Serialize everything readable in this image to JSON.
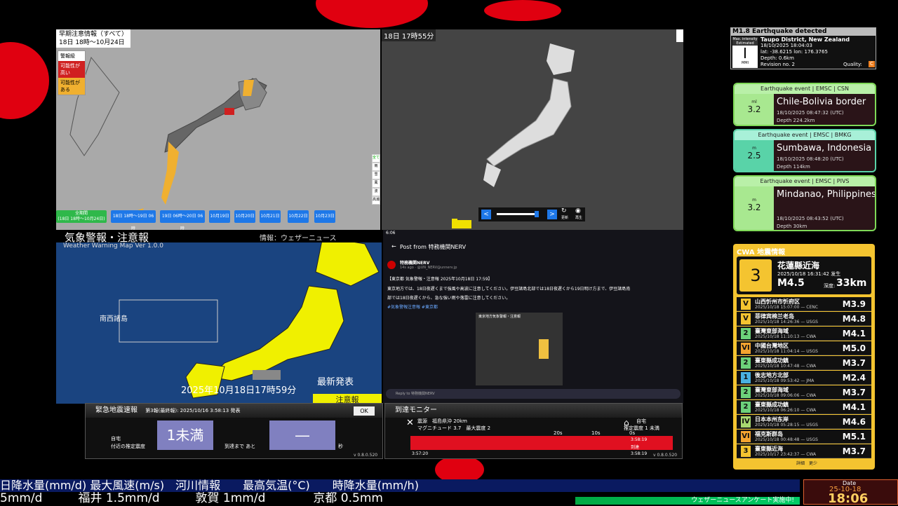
{
  "warning_map": {
    "title_line1": "早期注意情報（すべて）",
    "title_line2": "18日 18時〜10月24日",
    "legend": [
      "警報級",
      "可能性が高い",
      "可能性がある"
    ],
    "day_buttons": [
      "全期間\n(18日 18時〜10月24日)",
      "18日 18時〜19日 06時",
      "19日 06時〜20日 06時",
      "10月19日",
      "10月20日",
      "10月21日",
      "10月22日",
      "10月23日"
    ],
    "side_buttons": [
      "全て",
      "雨",
      "雪",
      "風",
      "波",
      "高潮"
    ]
  },
  "radar_map": {
    "title": "18日 17時55分",
    "controls": [
      "更新",
      "再生"
    ]
  },
  "weather_warning": {
    "title": "気象警報・注意報",
    "subtitle": "Weather Warning Map Ver 1.0.0",
    "info": "情報：ウェザーニュース",
    "region_label": "南西諸島",
    "latest": "最新発表",
    "timestamp": "2025年10月18日17時59分",
    "footer_tag": "注意報"
  },
  "social_post": {
    "status_time": "6:06",
    "header": "Post from 特務機関NERV",
    "author": "特務機関NERV",
    "author_meta": "14s ago · @UN_NERV@unnerv.jp",
    "line1": "【東京都 気象警報・注意報 2025年10月18日 17:59】",
    "line2": "東京地方では、18日夜遅くまで強風や高波に注意してください。伊豆諸島北部では18日夜遅くから19日明け方まで、伊豆諸島南",
    "line3": "部では18日夜遅くから、急な強い雨や落雷に注意してください。",
    "tags": "#気象警報注意報 #東京都",
    "image_title": "東京地方気象警報・注意報",
    "reply_placeholder": "Reply to 特務機関NERV"
  },
  "eew": {
    "title": "緊急地震速報",
    "report": "第3報(最終報): 2025/10/16 3:58:13 発表",
    "ok": "OK",
    "label_home": "自宅",
    "label_est": "付近の推定震度",
    "intensity": "1未満",
    "label_until": "到達まで あと",
    "countdown": "―",
    "unit_sec": "秒",
    "version": "v 0.8.0.520"
  },
  "arrival": {
    "title": "到達モニター",
    "source": "震源　福島県沖 20km",
    "magnitude": "マグニチュード 3.7　最大震度 2",
    "home": "自宅",
    "home_est": "推定震度 1 未満",
    "scale": [
      "20s",
      "10s",
      "0s"
    ],
    "arrive_time": "3:58:19",
    "arrive_label": "到達",
    "start": "3:57:20",
    "end": "3:58:19",
    "version": "v 0.8.0.520"
  },
  "detected": {
    "title": "M1.8 Earthquake detected",
    "place": "Taupo District, New Zealand",
    "time": "18/10/2025 18:04:03",
    "coords": "lat: -38.6215 lon: 176.3765",
    "depth": "Depth: 0.6km",
    "revision": "Revision no. 2",
    "quality_label": "Quality:",
    "quality": "C",
    "max_int_label": "Max. intensity Estimated",
    "intensity": "I",
    "scale": "MMI"
  },
  "events": [
    {
      "header": "Earthquake event | EMSC | CSN",
      "mtype": "ml",
      "mag": "3.2",
      "place": "Chile-Bolivia border",
      "time": "18/10/2025 08:47:32 (UTC)",
      "depth": "Depth 224.2km",
      "color": "#a8e890"
    },
    {
      "header": "Earthquake event | EMSC | BMKG",
      "mtype": "m",
      "mag": "2.5",
      "place": "Sumbawa, Indonesia",
      "time": "18/10/2025 08:48:20 (UTC)",
      "depth": "Depth 114km",
      "color": "#59d3a8"
    },
    {
      "header": "Earthquake event | EMSC | PIVS",
      "mtype": "m",
      "mag": "3.2",
      "place": "Mindanao, Philippines",
      "time": "18/10/2025 08:43:52 (UTC)",
      "depth": "Depth 30km",
      "color": "#a8e890"
    }
  ],
  "cwa": {
    "title": "CWA 地震情報",
    "intensity": "3",
    "place": "花蓮縣近海",
    "time": "2025/10/18 16:31:42 发生",
    "mag": "M4.5",
    "depth_label": "深度:",
    "depth": "33km",
    "rows": [
      {
        "int": "V",
        "loc": "山西忻州市忻府区",
        "dt": "2025/10/18 15:07:00 — CENC",
        "mag": "M3.9",
        "color": "#f4c430"
      },
      {
        "int": "V",
        "loc": "菲律宾棉兰老岛",
        "dt": "2025/10/18 14:26:36 — USGS",
        "mag": "M4.8",
        "color": "#f4c430"
      },
      {
        "int": "2",
        "loc": "臺灣東部海域",
        "dt": "2025/10/18 11:10:13 — CWA",
        "mag": "M4.1",
        "color": "#6cd17a"
      },
      {
        "int": "VI",
        "loc": "中國台灣地区",
        "dt": "2025/10/18 11:04:14 — USGS",
        "mag": "M5.0",
        "color": "#f4a430"
      },
      {
        "int": "2",
        "loc": "臺東縣成功鎮",
        "dt": "2025/10/18 10:47:48 — CWA",
        "mag": "M3.7",
        "color": "#6cd17a"
      },
      {
        "int": "1",
        "loc": "後志地方北部",
        "dt": "2025/10/18 09:53:42 — JMA",
        "mag": "M2.4",
        "color": "#4ab0e0"
      },
      {
        "int": "2",
        "loc": "臺灣東部海域",
        "dt": "2025/10/18 09:06:06 — CWA",
        "mag": "M3.7",
        "color": "#6cd17a"
      },
      {
        "int": "2",
        "loc": "臺東縣成功鎮",
        "dt": "2025/10/18 06:26:10 — CWA",
        "mag": "M4.1",
        "color": "#6cd17a"
      },
      {
        "int": "IV",
        "loc": "日本本州东岸",
        "dt": "2025/10/18 05:28:15 — USGS",
        "mag": "M4.6",
        "color": "#a8d870"
      },
      {
        "int": "VI",
        "loc": "福克斯群岛",
        "dt": "2025/10/18 00:48:48 — USGS",
        "mag": "M5.1",
        "color": "#f4a430"
      },
      {
        "int": "3",
        "loc": "臺東縣近海",
        "dt": "2025/10/17 23:42:37 — CWA",
        "mag": "M3.7",
        "color": "#f4c430"
      }
    ],
    "footer": "詳細　更少"
  },
  "ticker": {
    "line1": "日降水量(mm/d) 最大風速(m/s)　河川情報　　最高気温(°C)　　時降水量(mm/h)",
    "line2": "5mm/d　　　福井 1.5mm/d　　　敦賀 1mm/d　　　　京都 0.5mm",
    "banner": "ウェザーニュースアンケート実施中!"
  },
  "clock": {
    "label": "Date",
    "date": "25-10-18",
    "time": "18:06"
  }
}
